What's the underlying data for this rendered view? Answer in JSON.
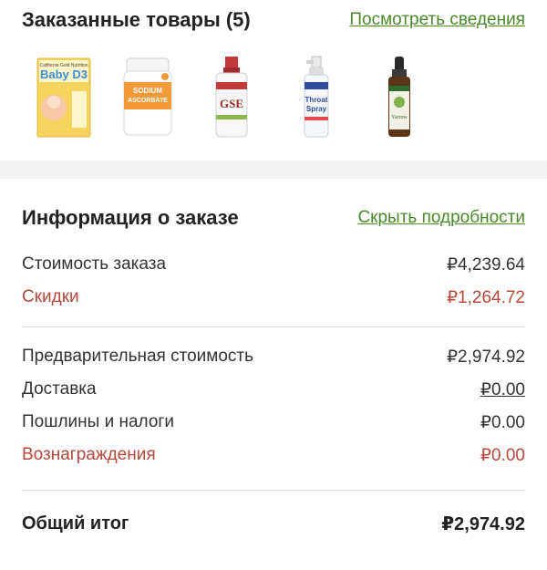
{
  "ordered_items": {
    "title": "Заказанные товары (5)",
    "details_link": "Посмотреть сведения",
    "products": [
      {
        "icon": "baby-d-drops-box",
        "label_lines": [
          "California Gold Nutrition",
          "Baby D3"
        ]
      },
      {
        "icon": "sodium-ascorbate-bottle",
        "label_lines": [
          "SODIUM",
          "ASCORBATE"
        ]
      },
      {
        "icon": "gse-bottle",
        "label_lines": [
          "GSE"
        ]
      },
      {
        "icon": "throat-spray-bottle",
        "label_lines": [
          "Throat",
          "Spray"
        ]
      },
      {
        "icon": "yarrow-dropper-bottle",
        "label_lines": [
          "Yarrow"
        ]
      }
    ]
  },
  "order_info": {
    "title": "Информация о заказе",
    "hide_link": "Скрыть подробности",
    "rows_top": [
      {
        "label": "Стоимость заказа",
        "value": "₽4,239.64"
      },
      {
        "label": "Скидки",
        "value": "₽1,264.72"
      }
    ],
    "rows_mid": [
      {
        "label": "Предварительная стоимость",
        "value": "₽2,974.92"
      },
      {
        "label": "Доставка",
        "value": "₽0.00"
      },
      {
        "label": "Пошлины и налоги",
        "value": "₽0.00"
      },
      {
        "label": "Вознаграждения",
        "value": "₽0.00"
      }
    ],
    "total": {
      "label": "Общий итог",
      "value": "₽2,974.92"
    }
  },
  "colors": {
    "accent_green": "#4a8a2c",
    "discount_red": "#b5483b"
  }
}
